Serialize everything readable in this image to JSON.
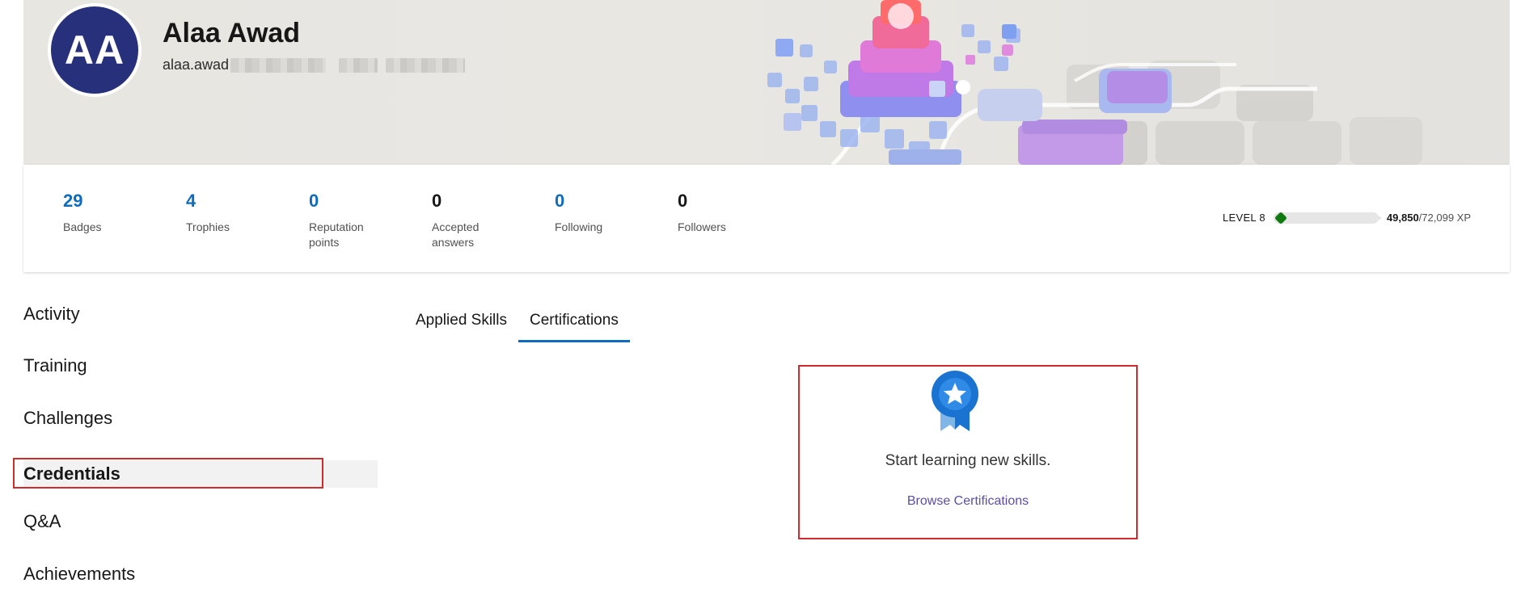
{
  "profile": {
    "initials": "AA",
    "name": "Alaa Awad",
    "handle_visible": "alaa.awad"
  },
  "stats": [
    {
      "value": "29",
      "label": "Badges",
      "value_color": "#0f6cbd"
    },
    {
      "value": "4",
      "label": "Trophies",
      "value_color": "#0f6cbd"
    },
    {
      "value": "0",
      "label": "Reputation points",
      "value_color": "#0f6cbd"
    },
    {
      "value": "0",
      "label": "Accepted answers",
      "value_color": "#171717"
    },
    {
      "value": "0",
      "label": "Following",
      "value_color": "#0f6cbd"
    },
    {
      "value": "0",
      "label": "Followers",
      "value_color": "#171717"
    }
  ],
  "level": {
    "label": "LEVEL 8",
    "xp_current": "49,850",
    "xp_max": "/72,099 XP",
    "progress_fraction": 0.0,
    "marker_color": "#0f7b0f"
  },
  "nav": {
    "items": [
      {
        "label": "Activity"
      },
      {
        "label": "Training"
      },
      {
        "label": "Challenges"
      },
      {
        "label": "Credentials",
        "active": true
      },
      {
        "label": "Q&A"
      },
      {
        "label": "Achievements"
      }
    ]
  },
  "tabs": [
    {
      "label": "Applied Skills",
      "active": false
    },
    {
      "label": "Certifications",
      "active": true
    }
  ],
  "empty_state": {
    "icon": "certification-badge-icon",
    "message": "Start learning new skills.",
    "link_label": "Browse Certifications"
  },
  "colors": {
    "accent": "#0f6cbd",
    "avatar_bg": "#27307a",
    "highlight_border": "#d12c2c",
    "link": "#5c4da8"
  }
}
